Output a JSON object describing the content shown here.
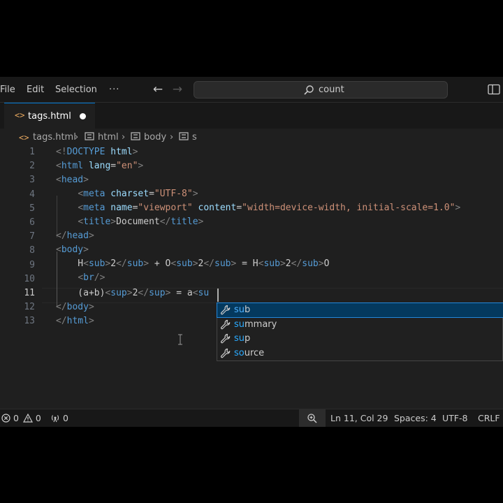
{
  "menu": {
    "file": "File",
    "edit": "Edit",
    "selection": "Selection",
    "more": "···"
  },
  "search": {
    "text": "count"
  },
  "tab": {
    "label": "tags.html"
  },
  "breadcrumb": {
    "file": "tags.html",
    "html": "html",
    "body": "body",
    "s": "s"
  },
  "editor": {
    "active_line": 11,
    "line_numbers": [
      "1",
      "2",
      "3",
      "4",
      "5",
      "6",
      "7",
      "8",
      "9",
      "10",
      "11",
      "12",
      "13"
    ]
  },
  "suggest": {
    "items": [
      {
        "match": "su",
        "rest": "b",
        "selected": true
      },
      {
        "match": "su",
        "rest": "mmary",
        "selected": false
      },
      {
        "match": "su",
        "rest": "p",
        "selected": false
      },
      {
        "match": "so",
        "rest": "urce",
        "selected": false
      }
    ]
  },
  "status": {
    "errors": "0",
    "warnings": "0",
    "ports": "0",
    "position": "Ln 11, Col 29",
    "spaces": "Spaces: 4",
    "encoding": "UTF-8",
    "eol": "CRLF"
  },
  "colors": {
    "accent": "#0078d4",
    "selection": "#04395e",
    "tag": "#569cd6",
    "attr": "#9cdcfe",
    "string": "#ce9178"
  }
}
